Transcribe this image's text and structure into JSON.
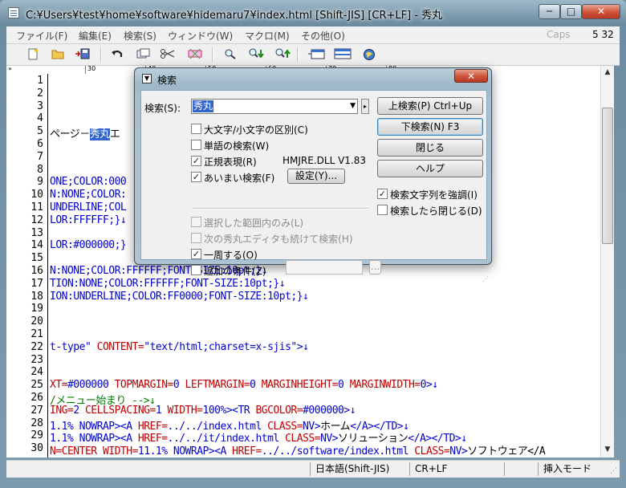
{
  "window": {
    "title": "C:¥Users¥test¥home¥software¥hidemaru7¥index.html  [Shift-JIS] [CR+LF] - 秀丸",
    "min_glyph": "─",
    "max_glyph": "□",
    "close_glyph": "✕"
  },
  "menu": {
    "items": [
      "ファイル(F)",
      "編集(E)",
      "検索(S)",
      "ウィンドウ(W)",
      "マクロ(M)",
      "その他(O)"
    ],
    "caps": "Caps",
    "cursor_pos": "5  32"
  },
  "toolbar": {
    "icons": [
      "new-file-icon",
      "open-folder-icon",
      "save-icon",
      "undo-icon",
      "copy-icon",
      "cut-icon",
      "paste-icon",
      "search-icon",
      "search-down-icon",
      "search-up-icon",
      "window-icon",
      "split-window-icon",
      "globe-icon"
    ]
  },
  "ruler": {
    "left_marker": "»",
    "labels": [
      "30",
      "40",
      "50",
      "60",
      "70",
      "80"
    ]
  },
  "editor": {
    "line_numbers": [
      "1",
      "2",
      "3",
      "4",
      "5",
      "6",
      "7",
      "8",
      "9",
      "10",
      "11",
      "12",
      "13",
      "14",
      "15",
      "16",
      "17",
      "18",
      "19",
      "20",
      "21",
      "22",
      "23",
      "24",
      "25",
      "26",
      "27",
      "28",
      "29",
      "30"
    ],
    "lines": [
      {
        "n": 5,
        "parts": [
          {
            "t": "ページ－",
            "c": "c-black"
          },
          {
            "t": "秀丸",
            "c": "hl"
          },
          {
            "t": "エ",
            "c": "c-black"
          }
        ]
      },
      {
        "n": 9,
        "parts": [
          {
            "t": "ONE;COLOR:000",
            "c": "c-blue"
          }
        ]
      },
      {
        "n": 10,
        "parts": [
          {
            "t": "N:NONE;COLOR:",
            "c": "c-blue"
          }
        ]
      },
      {
        "n": 11,
        "parts": [
          {
            "t": "UNDERLINE;COL",
            "c": "c-blue"
          }
        ]
      },
      {
        "n": 12,
        "parts": [
          {
            "t": "LOR:FFFFFF;}↓",
            "c": "c-blue"
          }
        ]
      },
      {
        "n": 14,
        "parts": [
          {
            "t": "LOR:#000000;}",
            "c": "c-blue"
          }
        ]
      },
      {
        "n": 16,
        "parts": [
          {
            "t": "N:NONE;COLOR:FFFFFF;FONT-SIZE:10pt;}↓",
            "c": "c-blue"
          }
        ]
      },
      {
        "n": 17,
        "parts": [
          {
            "t": "TION:NONE;COLOR:FFFFFF;FONT-SIZE:10pt;}↓",
            "c": "c-blue"
          }
        ]
      },
      {
        "n": 18,
        "parts": [
          {
            "t": "ION:UNDERLINE;COLOR:FF0000;FONT-SIZE:10pt;}↓",
            "c": "c-blue"
          }
        ]
      },
      {
        "n": 22,
        "parts": [
          {
            "t": "t-type\" ",
            "c": "c-blue"
          },
          {
            "t": "CONTENT=",
            "c": "c-red"
          },
          {
            "t": "\"text/html;charset=x-sjis\">↓",
            "c": "c-blue"
          }
        ]
      },
      {
        "n": 25,
        "parts": [
          {
            "t": "XT=",
            "c": "c-red"
          },
          {
            "t": "#000000 ",
            "c": "c-blue"
          },
          {
            "t": "TOPMARGIN=",
            "c": "c-red"
          },
          {
            "t": "0 ",
            "c": "c-blue"
          },
          {
            "t": "LEFTMARGIN=",
            "c": "c-red"
          },
          {
            "t": "0 ",
            "c": "c-blue"
          },
          {
            "t": "MARGINHEIGHT=",
            "c": "c-red"
          },
          {
            "t": "0 ",
            "c": "c-blue"
          },
          {
            "t": "MARGINWIDTH=",
            "c": "c-red"
          },
          {
            "t": "0>↓",
            "c": "c-blue"
          }
        ]
      },
      {
        "n": 26,
        "parts": [
          {
            "t": "/メニュー始まり -->↓",
            "c": "c-green"
          }
        ]
      },
      {
        "n": 27,
        "parts": [
          {
            "t": "ING=",
            "c": "c-red"
          },
          {
            "t": "2 ",
            "c": "c-blue"
          },
          {
            "t": "CELLSPACING=",
            "c": "c-red"
          },
          {
            "t": "1 ",
            "c": "c-blue"
          },
          {
            "t": "WIDTH=",
            "c": "c-red"
          },
          {
            "t": "100%><TR ",
            "c": "c-blue"
          },
          {
            "t": "BGCOLOR=",
            "c": "c-red"
          },
          {
            "t": "#000000>↓",
            "c": "c-blue"
          }
        ]
      },
      {
        "n": 28,
        "parts": [
          {
            "t": "1.1% NOWRAP><A ",
            "c": "c-blue"
          },
          {
            "t": "HREF=",
            "c": "c-red"
          },
          {
            "t": "../../index.html ",
            "c": "c-blue"
          },
          {
            "t": "CLASS=",
            "c": "c-red"
          },
          {
            "t": "NV>",
            "c": "c-blue"
          },
          {
            "t": "ホーム",
            "c": "c-black"
          },
          {
            "t": "</A></TD>↓",
            "c": "c-blue"
          }
        ]
      },
      {
        "n": 29,
        "parts": [
          {
            "t": "1.1% NOWRAP><A ",
            "c": "c-blue"
          },
          {
            "t": "HREF=",
            "c": "c-red"
          },
          {
            "t": "../../it/index.html ",
            "c": "c-blue"
          },
          {
            "t": "CLASS=",
            "c": "c-red"
          },
          {
            "t": "NV>",
            "c": "c-blue"
          },
          {
            "t": "ソリューション",
            "c": "c-black"
          },
          {
            "t": "</A></TD>↓",
            "c": "c-blue"
          }
        ]
      },
      {
        "n": 30,
        "parts": [
          {
            "t": "N=CENTER ",
            "c": "c-red"
          },
          {
            "t": "WIDTH=",
            "c": "c-red"
          },
          {
            "t": "11.1% NOWRAP><A ",
            "c": "c-blue"
          },
          {
            "t": "HREF=",
            "c": "c-red"
          },
          {
            "t": "../../software/index.html ",
            "c": "c-blue"
          },
          {
            "t": "CLASS=",
            "c": "c-red"
          },
          {
            "t": "NV>",
            "c": "c-blue"
          },
          {
            "t": "ソフトウェア</A",
            "c": "c-black"
          }
        ]
      }
    ]
  },
  "statusbar": {
    "encoding": "日本語(Shift-JIS)",
    "newline": "CR+LF",
    "mode": "挿入モード"
  },
  "dialog": {
    "title": "検索",
    "close_glyph": "✕",
    "search_label": "検索(S):",
    "search_value": "秀丸",
    "options": {
      "case": {
        "label": "大文字/小文字の区別(C)",
        "checked": false,
        "enabled": true
      },
      "word": {
        "label": "単語の検索(W)",
        "checked": false,
        "enabled": true
      },
      "regex": {
        "label": "正規表現(R)",
        "checked": true,
        "enabled": true
      },
      "fuzzy": {
        "label": "あいまい検索(F)",
        "checked": true,
        "enabled": true
      },
      "selection": {
        "label": "選択した範囲内のみ(L)",
        "checked": false,
        "enabled": false
      },
      "next_editor": {
        "label": "次の秀丸エディタも続けて検索(H)",
        "checked": false,
        "enabled": false
      },
      "wrap": {
        "label": "一周する(O)",
        "checked": true,
        "enabled": true
      },
      "extra": {
        "label": "追加の条件(Z)",
        "checked": false,
        "enabled": true
      },
      "emphasize": {
        "label": "検索文字列を強調(I)",
        "checked": true,
        "enabled": true
      },
      "close_after": {
        "label": "検索したら閉じる(D)",
        "checked": false,
        "enabled": true
      }
    },
    "dll_info": "HMJRE.DLL V1.83",
    "settings_button": "設定(Y)...",
    "buttons": {
      "search_up": "上検索(P) Ctrl+Up",
      "search_down": "下検索(N) F3",
      "close": "閉じる",
      "help": "ヘルプ",
      "browse": "..."
    }
  }
}
